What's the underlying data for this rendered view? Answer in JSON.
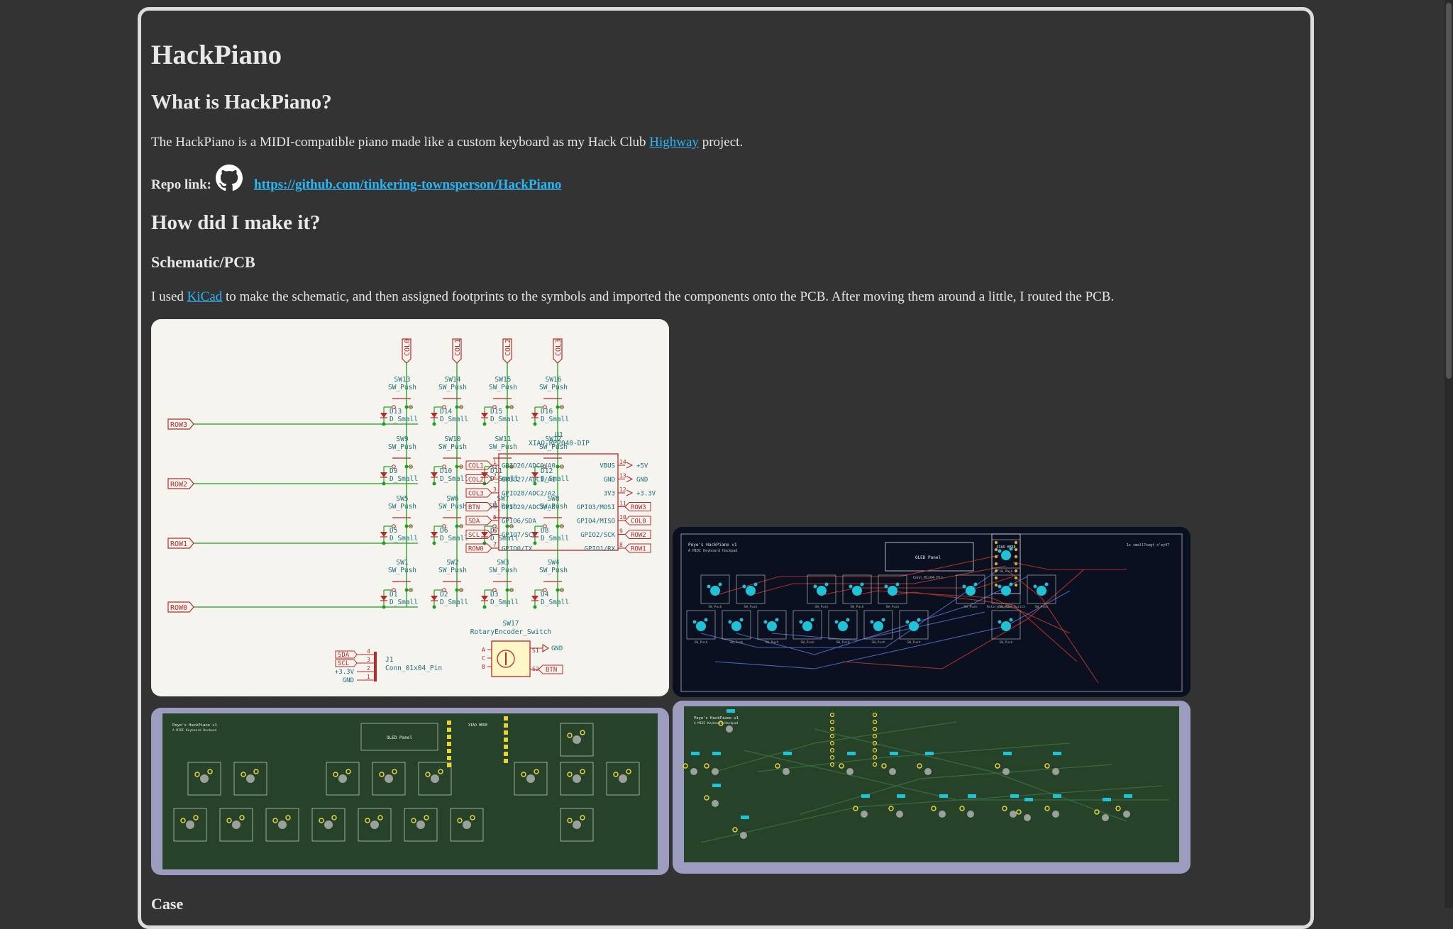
{
  "page": {
    "title": "HackPiano",
    "what_heading": "What is HackPiano?",
    "what_text_before": "The HackPiano is a MIDI-compatible piano made like a custom keyboard as my Hack Club ",
    "what_link": "Highway",
    "what_text_after": " project.",
    "repo_label": "Repo link:",
    "repo_url": "https://github.com/tinkering-townsperson/HackPiano",
    "how_heading": "How did I make it?",
    "schematic_heading": "Schematic/PCB",
    "kicad_text_before": "I used ",
    "kicad_link": "KiCad",
    "kicad_text_after": " to make the schematic, and then assigned footprints to the symbols and imported the components onto the PCB. After moving them around a little, I routed the PCB.",
    "case_heading": "Case"
  },
  "schematic": {
    "cols": [
      "COL0",
      "COL1",
      "COL2",
      "COL3"
    ],
    "rows": [
      "ROW3",
      "ROW2",
      "ROW1",
      "ROW0"
    ],
    "switches": [
      [
        "SW13",
        "SW14",
        "SW15",
        "SW16"
      ],
      [
        "SW9",
        "SW10",
        "SW11",
        "SW12"
      ],
      [
        "SW5",
        "SW6",
        "SW7",
        "SW8"
      ],
      [
        "SW1",
        "SW2",
        "SW3",
        "SW4"
      ]
    ],
    "diodes": [
      [
        "D13",
        "D14",
        "D15",
        "D16"
      ],
      [
        "D9",
        "D10",
        "D11",
        "D12"
      ],
      [
        "D5",
        "D6",
        "D7",
        "D8"
      ],
      [
        "D1",
        "D2",
        "D3",
        "D4"
      ]
    ],
    "sw_value": "SW_Push",
    "diode_value": "D_Small",
    "mcu_ref": "U1",
    "mcu_value": "XIAO-RP2040-DIP",
    "mcu_left_pins": [
      "GPIO26/ADC0/A0",
      "GPIO27/ADC1/A1",
      "GPIO28/ADC2/A2",
      "GPIO29/ADC3/A3",
      "GPIO6/SDA",
      "GPIO7/SCL",
      "GPIO0/TX"
    ],
    "mcu_left_nums": [
      "1",
      "2",
      "3",
      "4",
      "5",
      "6",
      "7"
    ],
    "mcu_left_nets": [
      "COL1",
      "COL2",
      "COL3",
      "BTN",
      "SDA",
      "SCL",
      "ROW0"
    ],
    "mcu_right_pins": [
      "VBUS",
      "GND",
      "3V3",
      "GPIO3/MOSI",
      "GPIO4/MISO",
      "GPIO2/SCK",
      "GPIO1/RX"
    ],
    "mcu_right_nums": [
      "14",
      "13",
      "12",
      "11",
      "10",
      "9",
      "8"
    ],
    "mcu_right_nets": [
      "+5V",
      "GND",
      "+3.3V",
      "ROW3",
      "COL0",
      "ROW2",
      "ROW1"
    ],
    "encoder_ref": "SW17",
    "encoder_value": "RotaryEncoder_Switch",
    "encoder_nets": [
      "GND",
      "BTN"
    ],
    "encoder_pins": [
      "A",
      "C",
      "B",
      "S1",
      "S2"
    ],
    "conn_ref": "J1",
    "conn_value": "Conn_01x04_Pin",
    "conn_nets": [
      "SDA",
      "SCL",
      "+3.3V",
      "GND"
    ],
    "conn_pins": [
      "4",
      "3",
      "2",
      "1"
    ]
  },
  "pcb": {
    "title": "Peye's HackPiano v1",
    "subtitle": "A MIDI Keyboard Hackpad",
    "xiao_label": "XIAO HERE",
    "oled_label": "OLED Panel",
    "sw_label": "SW_Push",
    "encoder_label": "RotaryEncoder_Switch",
    "conn_label": "Conn_01x04_Pin",
    "note": "1x small7segt x'ey47"
  },
  "colors": {
    "background": "#333333",
    "link": "#29b6f6",
    "schematic_bg": "#f5f4ef",
    "schematic_wire": "#1d9e1d",
    "schematic_symbol": "#b52a2a",
    "schematic_text": "#1f6f7a",
    "pcb_dark_bg": "#0b1020",
    "pcb_green_bg": "#264229",
    "pcb_frame": "#9c9cbf"
  },
  "icons": {
    "github": "github-icon"
  }
}
